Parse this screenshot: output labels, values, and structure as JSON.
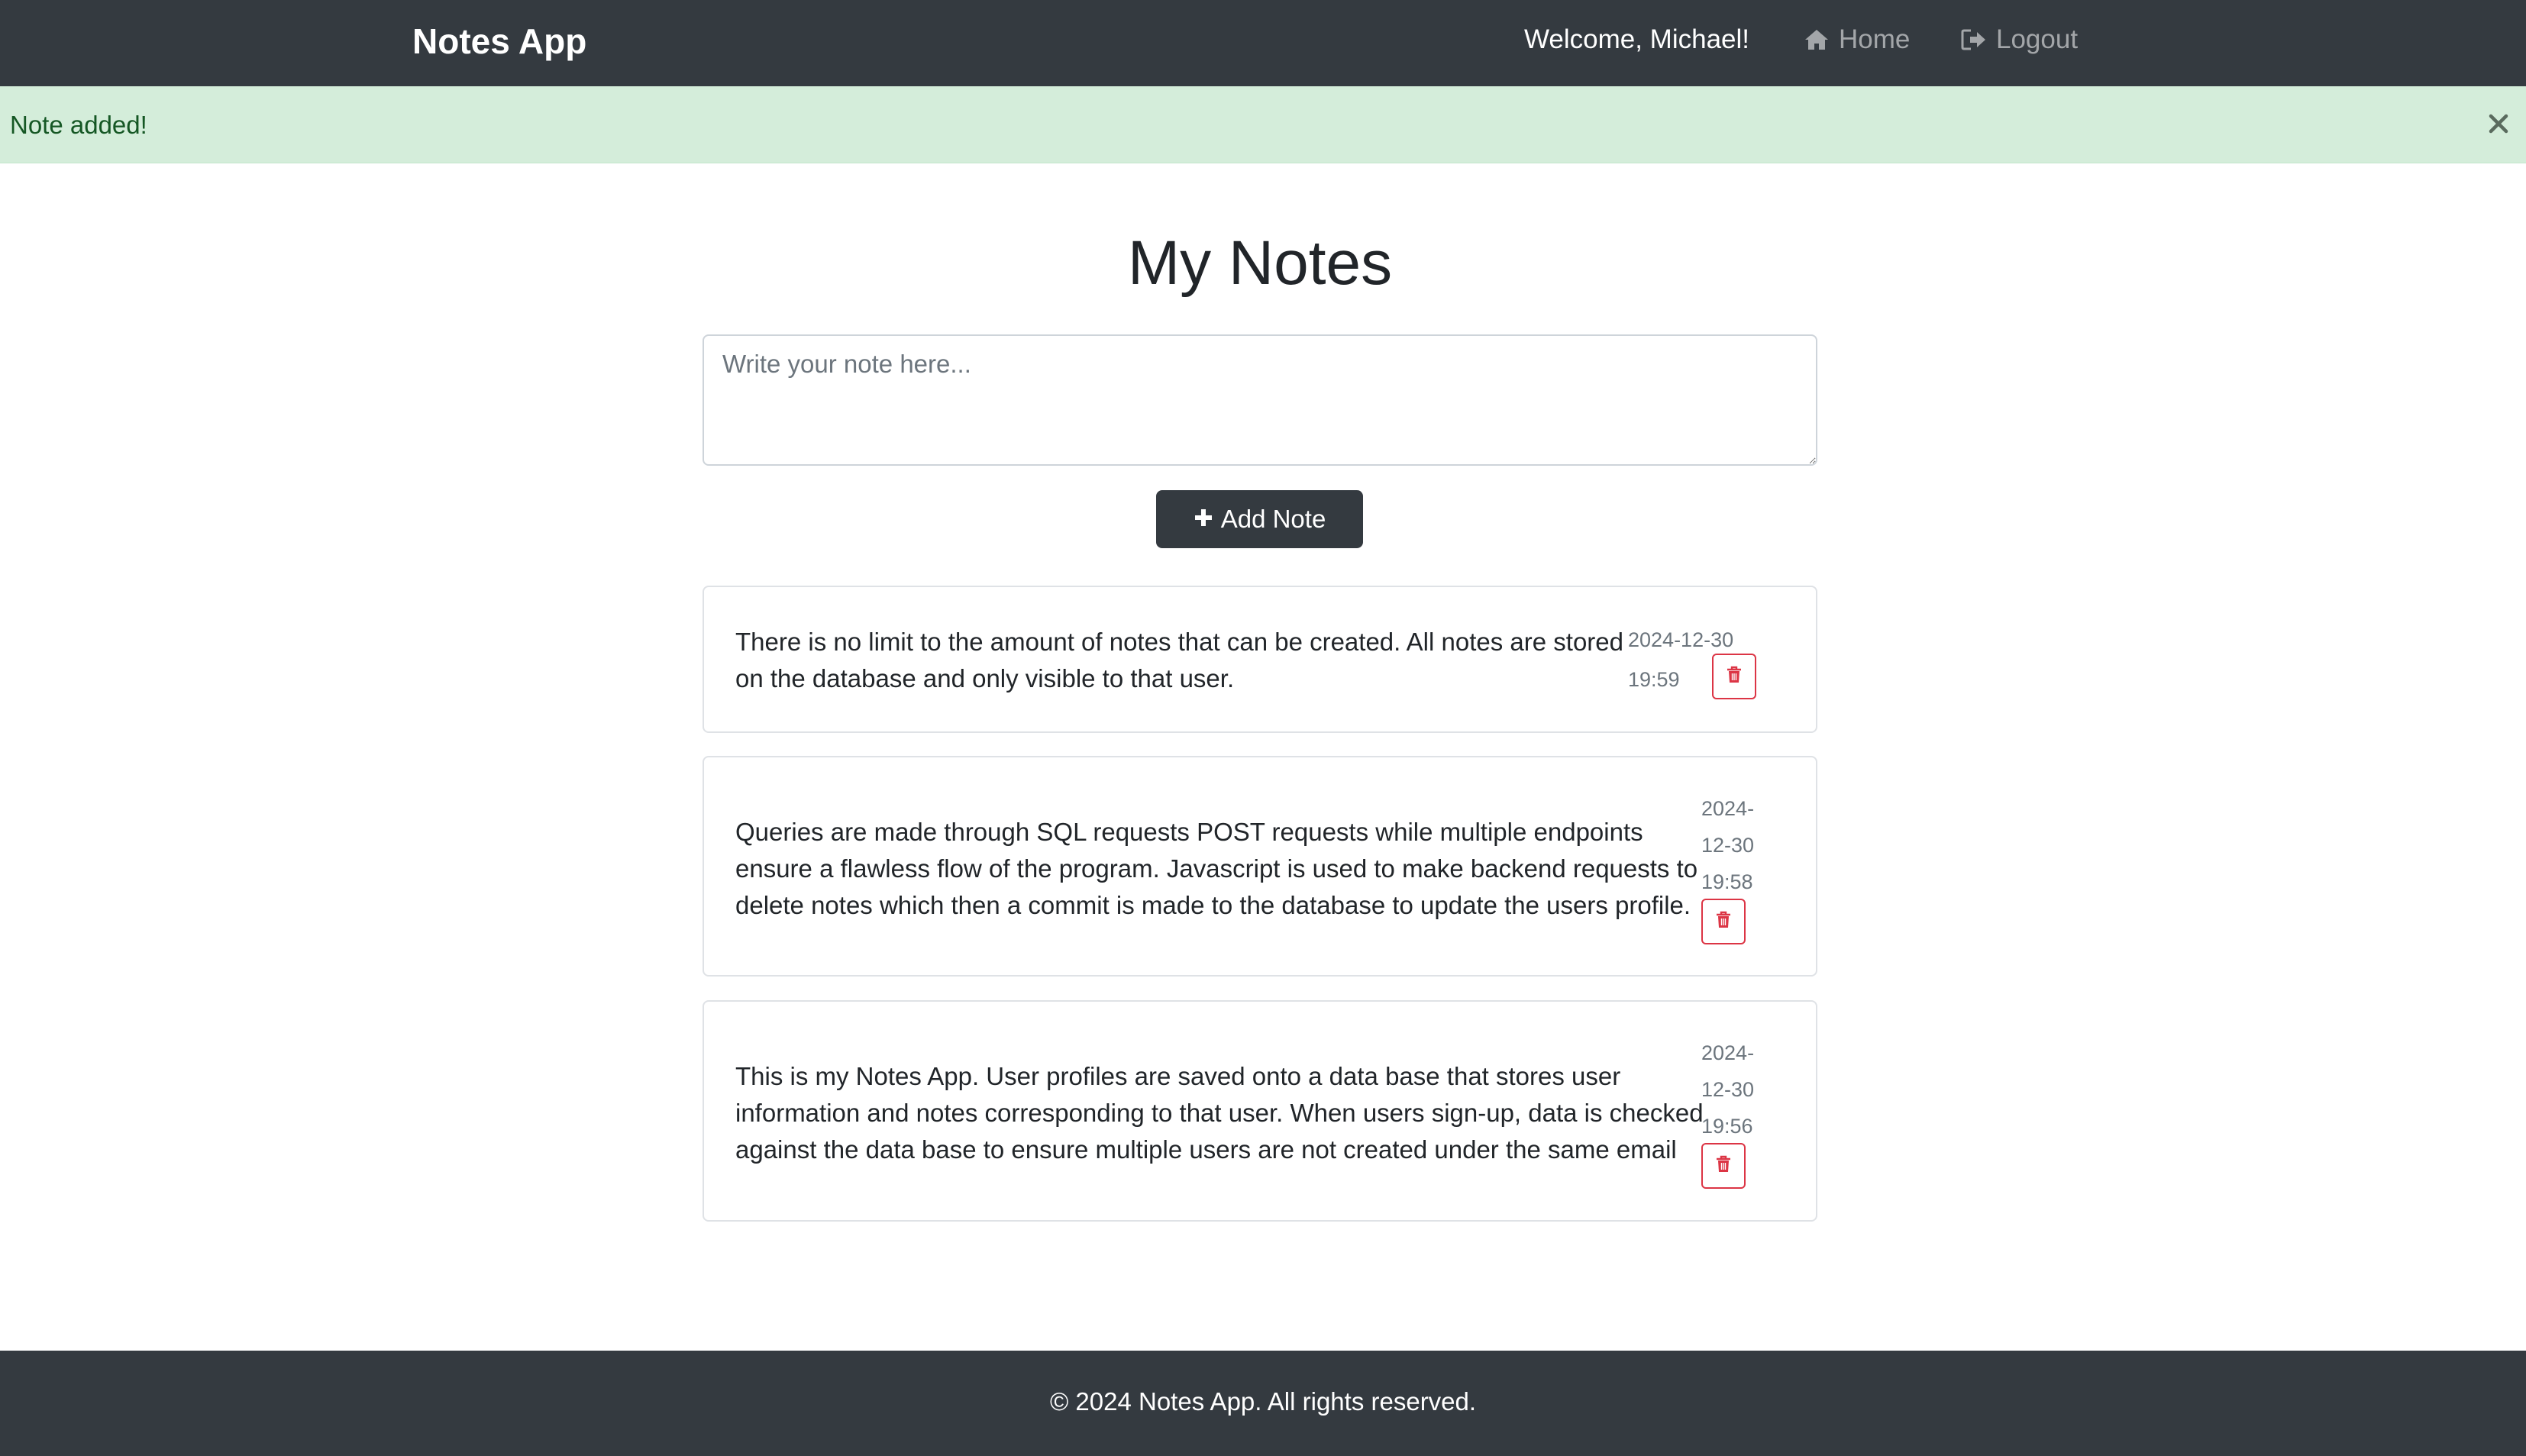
{
  "navbar": {
    "brand": "Notes App",
    "welcome": "Welcome, Michael!",
    "home_label": "Home",
    "logout_label": "Logout",
    "icons": {
      "home": "home-icon",
      "logout": "sign-out-icon"
    }
  },
  "alert": {
    "message": "Note added!",
    "close_glyph": "×",
    "type": "success"
  },
  "main": {
    "title": "My Notes",
    "note_input": {
      "placeholder": "Write your note here...",
      "value": ""
    },
    "add_button_label": "Add Note",
    "notes": [
      {
        "lines": [
          "There is no limit to the amount of notes that can be created. All notes are stored",
          "on the database and only visible to that user."
        ],
        "date_lines": [
          "2024-12-30",
          "19:59"
        ]
      },
      {
        "lines": [
          "Queries are made through SQL requests POST requests while multiple endpoints",
          "ensure a flawless flow of the program. Javascript is used to make backend requests to",
          "delete notes which then a commit is made to the database to update the users profile."
        ],
        "date_lines": [
          "2024-",
          "12-30",
          "19:58"
        ]
      },
      {
        "lines": [
          "This is my Notes App. User profiles are saved onto a data base that stores user",
          "information and notes corresponding to that user. When users sign-up, data is checked",
          "against the data base to ensure multiple users are not created under the same email"
        ],
        "date_lines": [
          "2024-",
          "12-30",
          "19:56"
        ]
      }
    ]
  },
  "footer": {
    "text": "© 2024 Notes App. All rights reserved."
  },
  "colors": {
    "navbar_bg": "#343a40",
    "alert_bg": "#d4edda",
    "alert_text": "#155724",
    "danger": "#dc3545"
  }
}
